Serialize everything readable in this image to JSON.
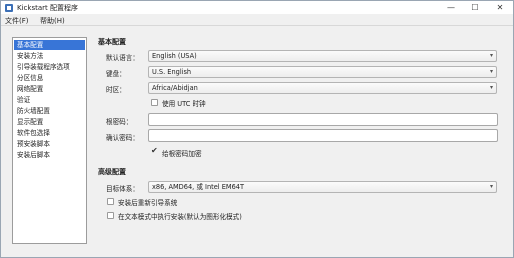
{
  "window": {
    "title": "Kickstart 配置程序",
    "minimize": "—",
    "maximize": "☐",
    "close": "✕"
  },
  "menu": {
    "file": "文件(F)",
    "help": "帮助(H)"
  },
  "sidebar": {
    "items": [
      {
        "label": "基本配置",
        "active": true
      },
      {
        "label": "安装方法"
      },
      {
        "label": "引导装载程序选项"
      },
      {
        "label": "分区信息"
      },
      {
        "label": "网络配置"
      },
      {
        "label": "验证"
      },
      {
        "label": "防火墙配置"
      },
      {
        "label": "显示配置"
      },
      {
        "label": "软件包选择"
      },
      {
        "label": "预安装脚本"
      },
      {
        "label": "安装后脚本"
      }
    ]
  },
  "basic": {
    "heading": "基本配置",
    "language_label": "默认语言：",
    "language_value": "English (USA)",
    "keyboard_label": "键盘：",
    "keyboard_value": "U.S. English",
    "timezone_label": "时区：",
    "timezone_value": "Africa/Abidjan",
    "utc_label": "使用 UTC 时钟",
    "root_password_label": "根密码：",
    "root_password_value": "",
    "confirm_password_label": "确认密码：",
    "confirm_password_value": "",
    "encrypt_label": "给根密码加密"
  },
  "advanced": {
    "heading": "高级配置",
    "arch_label": "目标体系：",
    "arch_value": "x86, AMD64, 或 Intel EM64T",
    "reboot_label": "安装后重新引导系统",
    "textmode_label": "在文本模式中执行安装(默认为图形化模式)"
  },
  "icons": {
    "dropdown": "▾"
  }
}
